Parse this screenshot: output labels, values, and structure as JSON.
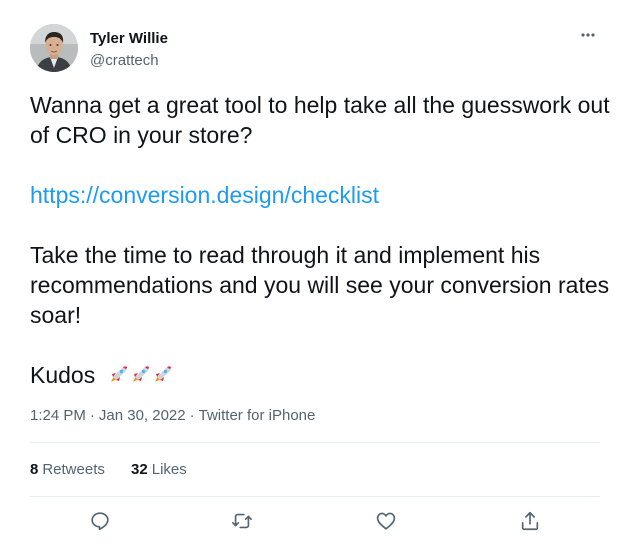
{
  "author": {
    "name": "Tyler Willie",
    "handle": "@crattech"
  },
  "tweet": {
    "line_1": "Wanna get a great tool to help take all the guesswork out",
    "line_2": "of CRO in your store?",
    "link": "https://conversion.design/checklist",
    "line_3": "Take the time to read through it and implement his",
    "line_4": "recommendations and you will see your conversion rates",
    "line_5": "soar!",
    "line_6": "Kudos"
  },
  "meta": {
    "time": "1:24 PM",
    "separator": "·",
    "date": "Jan 30, 2022",
    "source": "Twitter for iPhone"
  },
  "stats": {
    "retweets_count": "8",
    "retweets_label": "Retweets",
    "likes_count": "32",
    "likes_label": "Likes"
  },
  "icons": {
    "more": "more-dots-icon",
    "reply": "reply-icon",
    "retweet": "retweet-icon",
    "like": "heart-icon",
    "share": "share-icon",
    "rocket": "rocket-icon"
  },
  "colors": {
    "link": "#1d9bf0",
    "secondary_text": "#536471",
    "primary_text": "#0f1419",
    "divider": "#e6ecf0"
  }
}
